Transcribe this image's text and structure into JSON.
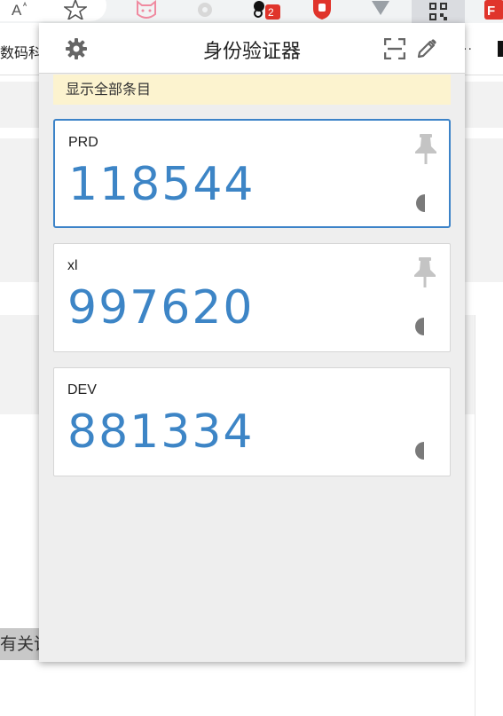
{
  "browser": {
    "bookmark_text": "数码科",
    "bookmark_overflow": "..",
    "extension_badge": "2",
    "page_fragment": "有关该"
  },
  "popup": {
    "title": "身份验证器",
    "icons": {
      "settings": "gear-icon",
      "scan": "scan-qr-icon",
      "edit": "pencil-icon"
    },
    "notice": "显示全部条目",
    "entries": [
      {
        "issuer": "PRD",
        "code": "118544",
        "selected": true
      },
      {
        "issuer": "xl",
        "code": "997620",
        "selected": false
      },
      {
        "issuer": "DEV",
        "code": "881334",
        "selected": false
      }
    ]
  },
  "colors": {
    "code": "#3d85c6",
    "selected_border": "#3c83c8",
    "notice_bg": "#fcf3cf",
    "popup_bg": "#eeeeee"
  }
}
